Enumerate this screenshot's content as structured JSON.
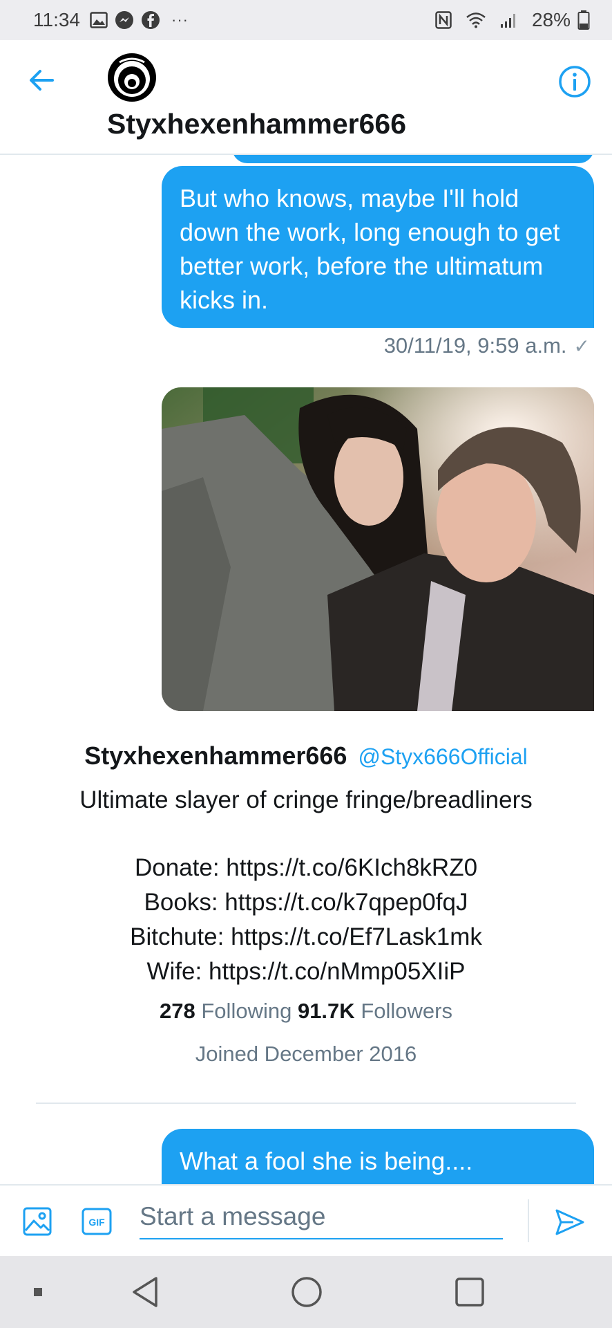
{
  "status_bar": {
    "time": "11:34",
    "battery": "28%",
    "left_icons": [
      "gallery-icon",
      "messenger-icon",
      "facebook-icon",
      "more-notifications-icon"
    ],
    "right_icons": [
      "nfc-icon",
      "wifi-icon",
      "signal-icon",
      "battery-icon"
    ]
  },
  "header": {
    "title": "Styxhexenhammer666",
    "back_icon": "arrow-left-icon",
    "info_icon": "info-icon"
  },
  "colors": {
    "accent": "#1da1f2",
    "secondary_text": "#657786",
    "primary_text": "#14171a"
  },
  "messages": [
    {
      "text": "But who knows, maybe I'll hold down the work, long enough to get better work, before the ultimatum kicks in.",
      "timestamp": "30/11/19, 9:59 a.m.",
      "status_icon": "check-icon"
    },
    {
      "type": "photo",
      "description_icon": "photo"
    },
    {
      "text": "What a fool she is being...."
    }
  ],
  "profile_card": {
    "name": "Styxhexenhammer666",
    "handle": "@Styx666Official",
    "bio_line1": "Ultimate slayer of cringe fringe/breadliners",
    "bio_links": [
      "Donate: https://t.co/6KIch8kRZ0",
      "Books: https://t.co/k7qpep0fqJ",
      "Bitchute: https://t.co/Ef7Lask1mk",
      "Wife: https://t.co/nMmp05XIiP"
    ],
    "following_count": "278",
    "following_label": "Following",
    "followers_count": "91.7K",
    "followers_label": "Followers",
    "joined": "Joined December 2016"
  },
  "composer": {
    "placeholder": "Start a message",
    "value": "",
    "gif_label": "GIF"
  },
  "nav_bar": {
    "items": [
      "recent-dot-icon",
      "back-triangle-icon",
      "home-circle-icon",
      "overview-square-icon"
    ]
  }
}
